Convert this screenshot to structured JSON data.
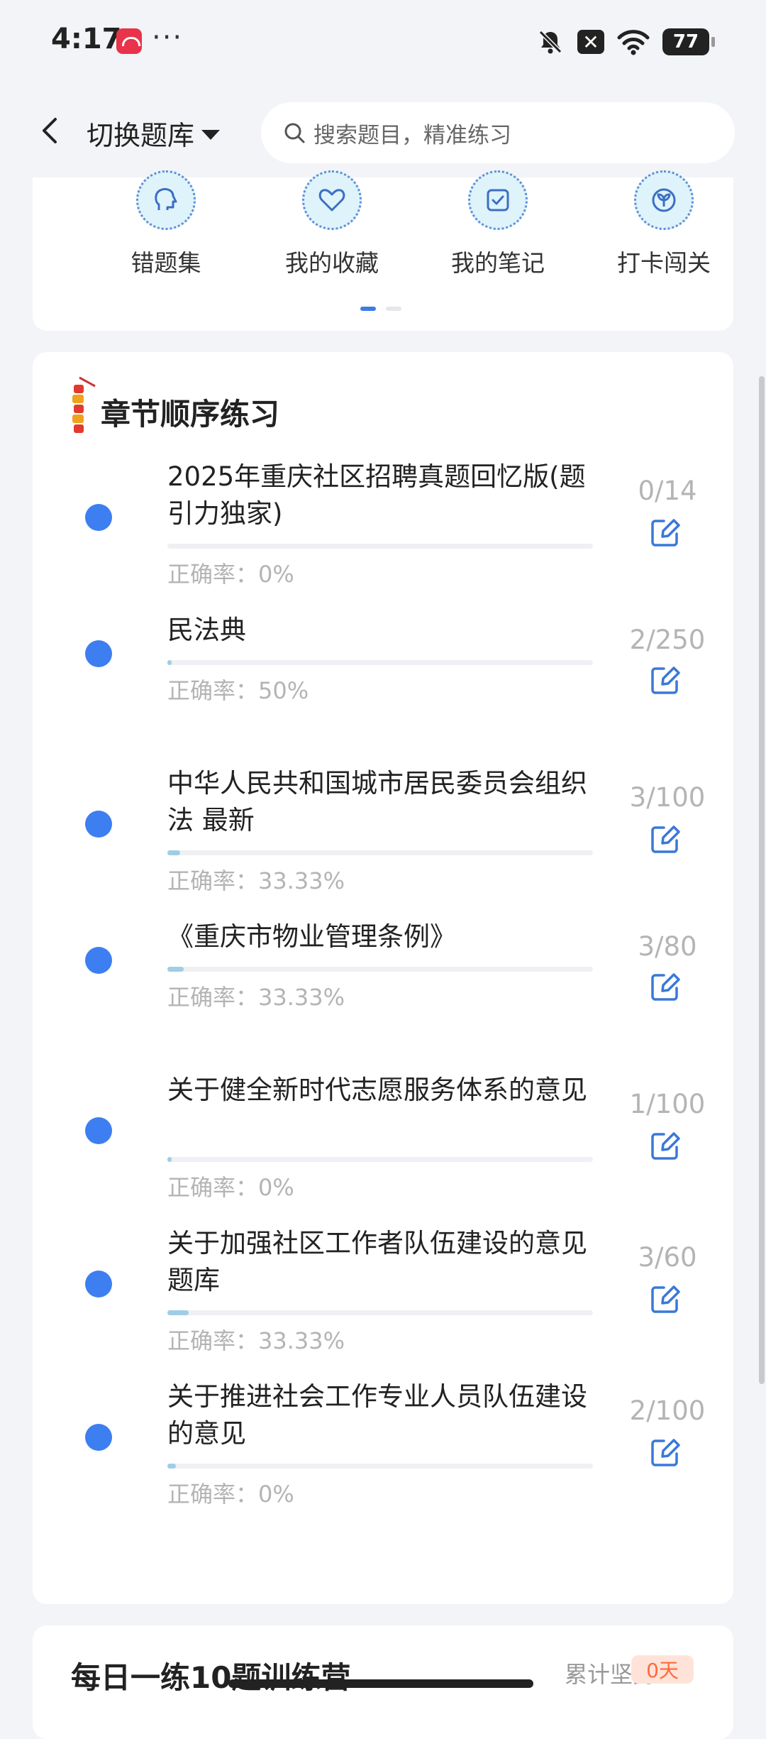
{
  "status_bar": {
    "time": "4:17",
    "dots": "···",
    "battery": "77"
  },
  "header": {
    "switch_label": "切换题库",
    "search_placeholder": "搜索题目，精准练习"
  },
  "tools": [
    {
      "label": "错题集",
      "icon": "head-icon"
    },
    {
      "label": "我的收藏",
      "icon": "heart-icon"
    },
    {
      "label": "我的笔记",
      "icon": "note-check-icon"
    },
    {
      "label": "打卡闯关",
      "icon": "sprout-icon"
    }
  ],
  "chapter_section": {
    "title": "章节顺序练习",
    "items": [
      {
        "title": "2025年重庆社区招聘真题回忆版(题引力独家)",
        "accuracy_label": "正确率：0%",
        "count": "0/14",
        "done": 0,
        "total": 14
      },
      {
        "title": "民法典",
        "accuracy_label": "正确率：50%",
        "count": "2/250",
        "done": 2,
        "total": 250
      },
      {
        "title": "中华人民共和国城市居民委员会组织法 最新",
        "accuracy_label": "正确率：33.33%",
        "count": "3/100",
        "done": 3,
        "total": 100
      },
      {
        "title": "《重庆市物业管理条例》",
        "accuracy_label": "正确率：33.33%",
        "count": "3/80",
        "done": 3,
        "total": 80
      },
      {
        "title": "关于健全新时代志愿服务体系的意见",
        "accuracy_label": "正确率：0%",
        "count": "1/100",
        "done": 1,
        "total": 100
      },
      {
        "title": "关于加强社区工作者队伍建设的意见题库",
        "accuracy_label": "正确率：33.33%",
        "count": "3/60",
        "done": 3,
        "total": 60
      },
      {
        "title": "关于推进社会工作专业人员队伍建设的意见",
        "accuracy_label": "正确率：0%",
        "count": "2/100",
        "done": 2,
        "total": 100
      }
    ]
  },
  "daily_section": {
    "title": "每日一练10题训练营",
    "right_text": "累计坚持",
    "badge": "0天"
  }
}
